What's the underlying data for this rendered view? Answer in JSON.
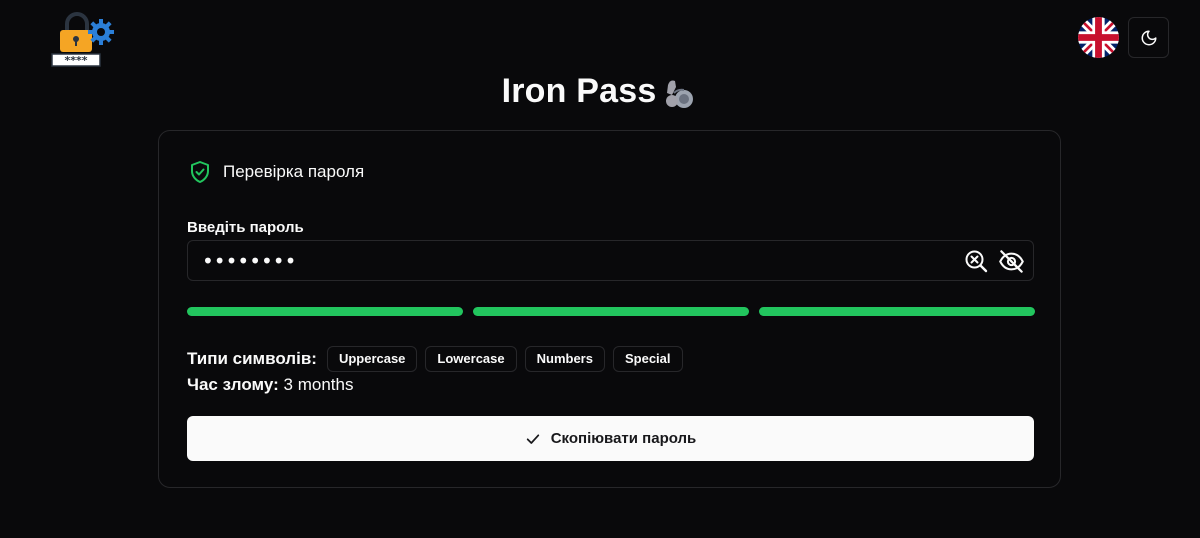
{
  "header": {
    "logo": "lock-gear-password-logo",
    "title": "Iron Pass",
    "title_icon": "flexed-biceps-icon",
    "language_flag": "uk-flag-icon",
    "theme_icon": "moon-icon"
  },
  "card": {
    "title": "Перевірка пароля",
    "title_icon": "shield-check-icon",
    "input_label": "Введіть пароль",
    "password_value": "********",
    "strength": {
      "segments_filled": 3,
      "segments_total": 3,
      "color": "#22c55e"
    },
    "types_label": "Типи символів:",
    "types": [
      "Uppercase",
      "Lowercase",
      "Numbers",
      "Special"
    ],
    "crack_label": "Час злому:",
    "crack_value": "3 months",
    "copy_button": "Скопіювати пароль"
  },
  "colors": {
    "background": "#09090b",
    "border": "#27272a",
    "accent_green": "#22c55e",
    "button_bg": "#fafafa"
  }
}
